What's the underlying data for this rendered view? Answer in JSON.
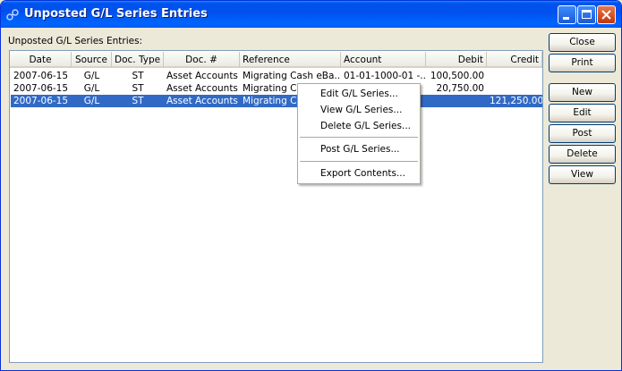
{
  "window": {
    "title": "Unposted G/L Series Entries"
  },
  "list_label": "Unposted G/L Series Entries:",
  "table": {
    "columns": [
      "Date",
      "Source",
      "Doc. Type",
      "Doc. #",
      "Reference",
      "Account",
      "Debit",
      "Credit"
    ],
    "rows": [
      [
        "2007-06-15",
        "G/L",
        "ST",
        "Asset Accounts",
        "Migrating Cash eBa...",
        "01-01-1000-01 -...",
        "100,500.00",
        ""
      ],
      [
        "2007-06-15",
        "G/L",
        "ST",
        "Asset Accounts",
        "Migrating Cas",
        "",
        "20,750.00",
        ""
      ],
      [
        "2007-06-15",
        "G/L",
        "ST",
        "Asset Accounts",
        "Migrating Cas",
        "",
        "",
        "121,250.00"
      ]
    ],
    "selected_row": 2
  },
  "buttons": {
    "close": "Close",
    "print": "Print",
    "new": "New",
    "edit": "Edit",
    "post": "Post",
    "delete": "Delete",
    "view": "View"
  },
  "context_menu": {
    "edit": "Edit G/L Series...",
    "view": "View G/L Series...",
    "delete": "Delete G/L Series...",
    "post": "Post G/L Series...",
    "export": "Export Contents..."
  },
  "colors": {
    "selection": "#316ac5",
    "titlebar": "#0053ee",
    "face": "#ece9d8"
  }
}
